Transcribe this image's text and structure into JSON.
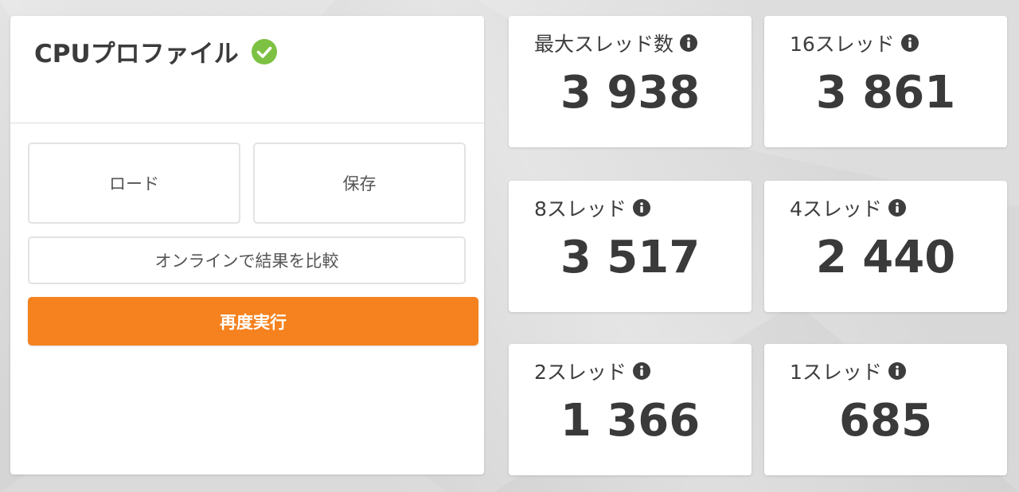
{
  "profile": {
    "title": "CPUプロファイル",
    "status_icon": "check-circle-icon",
    "status_color": "#7cc142",
    "buttons": {
      "load": "ロード",
      "save": "保存",
      "compare_online": "オンラインで結果を比較",
      "rerun": "再度実行"
    },
    "accent_color": "#f5821f"
  },
  "scores": [
    {
      "label": "最大スレッド数",
      "value": "3 938",
      "icon": "info-icon"
    },
    {
      "label": "16スレッド",
      "value": "3 861",
      "icon": "info-icon"
    },
    {
      "label": "8スレッド",
      "value": "3 517",
      "icon": "info-icon"
    },
    {
      "label": "4スレッド",
      "value": "2 440",
      "icon": "info-icon"
    },
    {
      "label": "2スレッド",
      "value": "1 366",
      "icon": "info-icon"
    },
    {
      "label": "1スレッド",
      "value": "685",
      "icon": "info-icon"
    }
  ]
}
